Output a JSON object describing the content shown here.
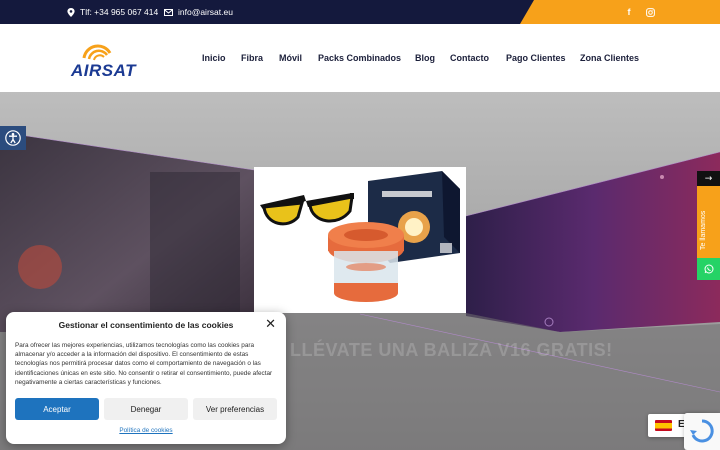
{
  "topbar": {
    "phone": "Tlf: +34 965 067 414",
    "email": "info@airsat.eu",
    "social": [
      {
        "icon": "facebook-icon",
        "glyph": "f"
      },
      {
        "icon": "instagram-icon",
        "glyph": "◎"
      }
    ]
  },
  "brand": {
    "logo_text": "AIRSAT",
    "logo_color": "#1b3a93",
    "accent": "#f7a11a"
  },
  "nav": {
    "items": [
      {
        "label": "Inicio"
      },
      {
        "label": "Fibra"
      },
      {
        "label": "Móvil"
      },
      {
        "label": "Packs Combinados"
      },
      {
        "label": "Blog"
      },
      {
        "label": "Contacto"
      },
      {
        "label": "Pago Clientes"
      },
      {
        "label": "Zona Clientes"
      }
    ]
  },
  "hero": {
    "headline": "LLÉVATE UNA BALIZA V16 GRATIS!"
  },
  "side_widget": {
    "arrow": "→",
    "call_label": "Te llamamos"
  },
  "cookie": {
    "title": "Gestionar el consentimiento de las cookies",
    "close": "✕",
    "body": "Para ofrecer las mejores experiencias, utilizamos tecnologías como las cookies para almacenar y/o acceder a la información del dispositivo. El consentimiento de estas tecnologías nos permitirá procesar datos como el comportamiento de navegación o las identificaciones únicas en este sitio. No consentir o retirar el consentimiento, puede afectar negativamente a ciertas características y funciones.",
    "accept_label": "Aceptar",
    "deny_label": "Denegar",
    "prefs_label": "Ver preferencias",
    "policy_link": "Política de cookies"
  },
  "language": {
    "code": "ES",
    "chevron": "^"
  },
  "colors": {
    "topbar": "#14193d",
    "orange": "#f7a11a",
    "nav_text": "#1b1f3a",
    "accept_button": "#1e73be",
    "whatsapp": "#25d366"
  }
}
